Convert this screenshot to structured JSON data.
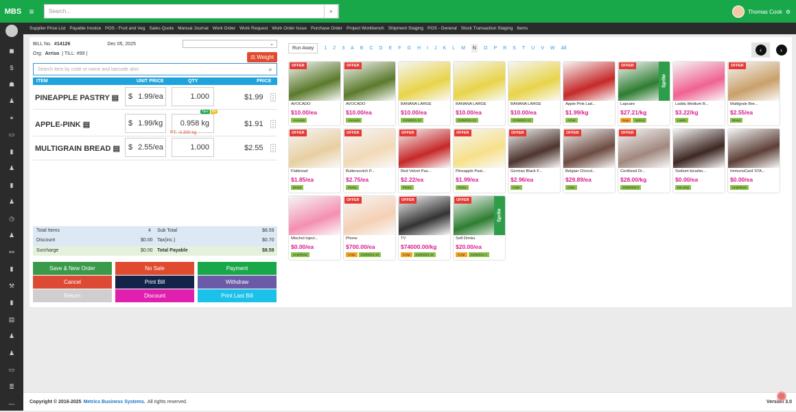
{
  "app": {
    "brand": "MBS",
    "search_placeholder": "Search...",
    "user_name": "Thomas Cook"
  },
  "nav": [
    "Supplier Price List",
    "Payable Invoice",
    "POS - Fruit and Veg",
    "Sales Quote",
    "Manual Journal",
    "Work Order",
    "Work Request",
    "Work Order Issue",
    "Purchase Order",
    "Project Workbench",
    "Shipment Staging",
    "POS - General",
    "Stock Transaction Staging",
    "Items"
  ],
  "sidebar_icons": [
    "dashboard-icon",
    "dollar-icon",
    "users-icon",
    "user-icon",
    "share-icon",
    "card-icon",
    "chart-icon",
    "person-icon",
    "bar-icon",
    "person2-icon",
    "clock-icon",
    "user3-icon",
    "link-icon",
    "chart2-icon",
    "wrench-icon",
    "chart3-icon",
    "doc-icon",
    "user4-icon",
    "user5-icon",
    "card2-icon",
    "list-icon",
    "minus-icon"
  ],
  "bill": {
    "bill_no_label": "BILL No.",
    "bill_no": "#14126",
    "date": "Dec 05, 2025",
    "org_label": "Org:",
    "org": "Arriso",
    "till": "| TILL: #99 |",
    "weight_label": "Weight",
    "search_placeholder": "Search item by code or name and barcode also"
  },
  "table_headers": {
    "item": "ITEM",
    "unit_price": "UNIT PRICE",
    "qty": "QTY",
    "price": "PRICE"
  },
  "items": [
    {
      "name": "PINEAPPLE PASTRY",
      "currency": "$",
      "unit_price": "1.99/ea",
      "qty": "1.000",
      "total": "$1.99"
    },
    {
      "name": "APPLE-PINK",
      "currency": "$",
      "unit_price": "1.99/kg",
      "qty": "0.958 kg",
      "total": "$1.91",
      "note": "PT: -0.300 kg",
      "badge1": "Tare",
      "badge2": "Wt"
    },
    {
      "name": "MULTIGRAIN BREAD",
      "currency": "$",
      "unit_price": "2.55/ea",
      "qty": "1.000",
      "total": "$2.55"
    }
  ],
  "totals": {
    "total_items_label": "Total Items",
    "total_items": "4",
    "subtotal_label": "Sub Total",
    "subtotal": "$8.59",
    "discount_label": "Discount",
    "discount": "$0.00",
    "tax_label": "Tax(inc.)",
    "tax": "$0.70",
    "surcharge_label": "Surcharge",
    "surcharge": "$0.00",
    "payable_label": "Total Payable",
    "payable": "$8.59"
  },
  "actions": {
    "save_new": "Save & New Order",
    "no_sale": "No Sale",
    "payment": "Payment",
    "cancel": "Cancel",
    "print_bill": "Print Bill",
    "withdraw": "Withdraw",
    "return": "Return",
    "discount": "Discount",
    "print_last": "Print Last Bill"
  },
  "alpha_nav": {
    "run_away": "Run Away",
    "letters": [
      "1",
      "2",
      "3",
      "A",
      "B",
      "C",
      "D",
      "E",
      "F",
      "G",
      "H",
      "I",
      "J",
      "K",
      "L",
      "M",
      "N",
      "O",
      "P",
      "R",
      "S",
      "T",
      "U",
      "V",
      "W",
      "All"
    ],
    "active": "N"
  },
  "products": [
    {
      "name": "AVOCADO",
      "price": "$10.00/ea",
      "offer": true,
      "tags": [
        "Avocado"
      ],
      "color": "#5b7a2c"
    },
    {
      "name": "AVOCADO",
      "price": "$10.00/ea",
      "offer": true,
      "tags": [
        "Avocado"
      ],
      "color": "#5b7a2c"
    },
    {
      "name": "BANANA LARGE",
      "price": "$10.00/ea",
      "offer": false,
      "tags": [
        "21092021-12"
      ],
      "color": "#e8d44a"
    },
    {
      "name": "BANANA LARGE",
      "price": "$10.00/ea",
      "offer": false,
      "tags": [
        "21092021-12"
      ],
      "color": "#e8d44a"
    },
    {
      "name": "BANANA LARGE",
      "price": "$10.00/ea",
      "offer": false,
      "tags": [
        "21092021-12"
      ],
      "color": "#e8d44a"
    },
    {
      "name": "Apple Pink Lad...",
      "price": "$1.99/kg",
      "offer": false,
      "tags": [
        "Achar"
      ],
      "color": "#c62828"
    },
    {
      "name": "Lapcare",
      "price": "$27.21/kg",
      "offer": true,
      "tags": [
        "Bags",
        "Apricot"
      ],
      "color": "#2e7d32",
      "side": "Sprite"
    },
    {
      "name": "Laddu Medium B...",
      "price": "$3.22/kg",
      "offer": false,
      "tags": [
        "Laddu"
      ],
      "color": "#f06292"
    },
    {
      "name": "Multigrain Bre...",
      "price": "$2.55/ea",
      "offer": true,
      "tags": [
        "Bread"
      ],
      "color": "#c9a06a"
    },
    {
      "name": "Flatbread",
      "price": "$1.85/ea",
      "offer": true,
      "tags": [
        "Bread"
      ],
      "color": "#e8cfa2"
    },
    {
      "name": "Butterscotch P...",
      "price": "$2.75/ea",
      "offer": true,
      "tags": [
        "Pastry"
      ],
      "color": "#f2d9b8"
    },
    {
      "name": "Red Velvet Pas...",
      "price": "$2.22/ea",
      "offer": true,
      "tags": [
        "Pastry"
      ],
      "color": "#c62828"
    },
    {
      "name": "Pineapple Past...",
      "price": "$1.99/ea",
      "offer": true,
      "tags": [
        "Pastry"
      ],
      "color": "#f7e08a"
    },
    {
      "name": "German Black F...",
      "price": "$2.96/ea",
      "offer": true,
      "tags": [
        "Cake"
      ],
      "color": "#4e342e"
    },
    {
      "name": "Belgian Chocol...",
      "price": "$29.89/ea",
      "offer": true,
      "tags": [
        "Cake"
      ],
      "color": "#6d4c41"
    },
    {
      "name": "Certilized Di...",
      "price": "$28.00/kg",
      "offer": true,
      "tags": [
        "20092029-2"
      ],
      "color": "#a1887f"
    },
    {
      "name": "Sodium bicarbo...",
      "price": "$0.00/ea",
      "offer": false,
      "tags": [
        "Ear drop"
      ],
      "color": "#3e2723"
    },
    {
      "name": "ImmunoCard STA...",
      "price": "$0.00/ea",
      "offer": false,
      "tags": [
        "Undefined"
      ],
      "color": "#5d4037"
    },
    {
      "name": "Mischol inject...",
      "price": "$0.00/ea",
      "offer": false,
      "tags": [
        "Undefined"
      ],
      "color": "#f48fb1"
    },
    {
      "name": "Phone",
      "price": "$700.00/ea",
      "offer": true,
      "tags": [
        "Crisp",
        "21092021-18"
      ],
      "color": "#f5d0b5"
    },
    {
      "name": "TV",
      "price": "$74000.00/kg",
      "offer": true,
      "tags": [
        "Crisp",
        "21092021-11"
      ],
      "color": "#333333"
    },
    {
      "name": "Soft Drinks",
      "price": "$20.00/ea",
      "offer": true,
      "tags": [
        "Crisp",
        "21092021-1"
      ],
      "color": "#2e7d32",
      "side": "Sprite"
    }
  ],
  "offer_label": "OFFER",
  "footer": {
    "copyright": "Copyright © 2016-2025",
    "company": "Metrics Business Systems.",
    "rights": "All rights reserved.",
    "version": "Version 3.0"
  }
}
